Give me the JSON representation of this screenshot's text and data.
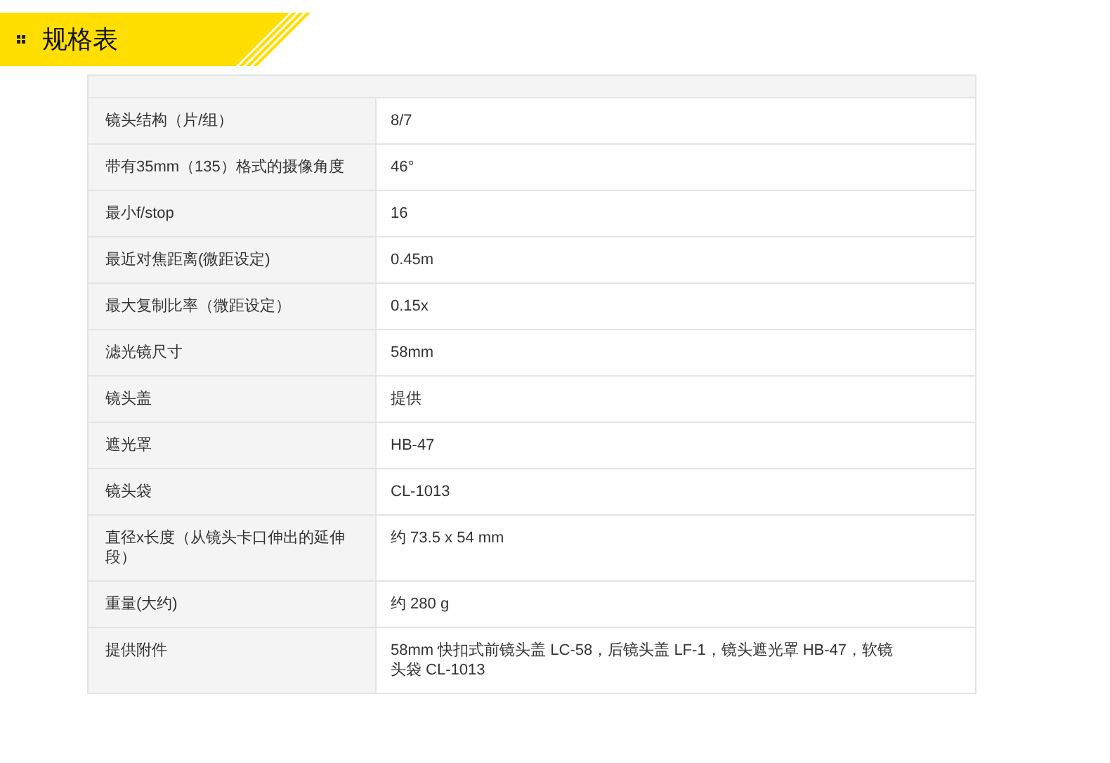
{
  "heading": "规格表",
  "specs": [
    {
      "label": "镜头结构（片/组）",
      "value": "8/7"
    },
    {
      "label": "带有35mm（135）格式的摄像角度",
      "value": "46°"
    },
    {
      "label": "最小f/stop",
      "value": "16"
    },
    {
      "label": "最近对焦距离(微距设定)",
      "value": "0.45m"
    },
    {
      "label": "最大复制比率（微距设定）",
      "value": "0.15x"
    },
    {
      "label": "滤光镜尺寸",
      "value": "58mm"
    },
    {
      "label": "镜头盖",
      "value": "提供"
    },
    {
      "label": "遮光罩",
      "value": "HB-47"
    },
    {
      "label": "镜头袋",
      "value": "CL-1013"
    },
    {
      "label": "直径x长度（从镜头卡口伸出的延伸段）",
      "value": "约 73.5 x 54 mm"
    },
    {
      "label": "重量(大约)",
      "value": "约 280 g"
    },
    {
      "label": "提供附件",
      "value": "58mm 快扣式前镜头盖 LC-58，后镜头盖 LF-1，镜头遮光罩 HB-47，软镜头袋 CL-1013"
    }
  ]
}
